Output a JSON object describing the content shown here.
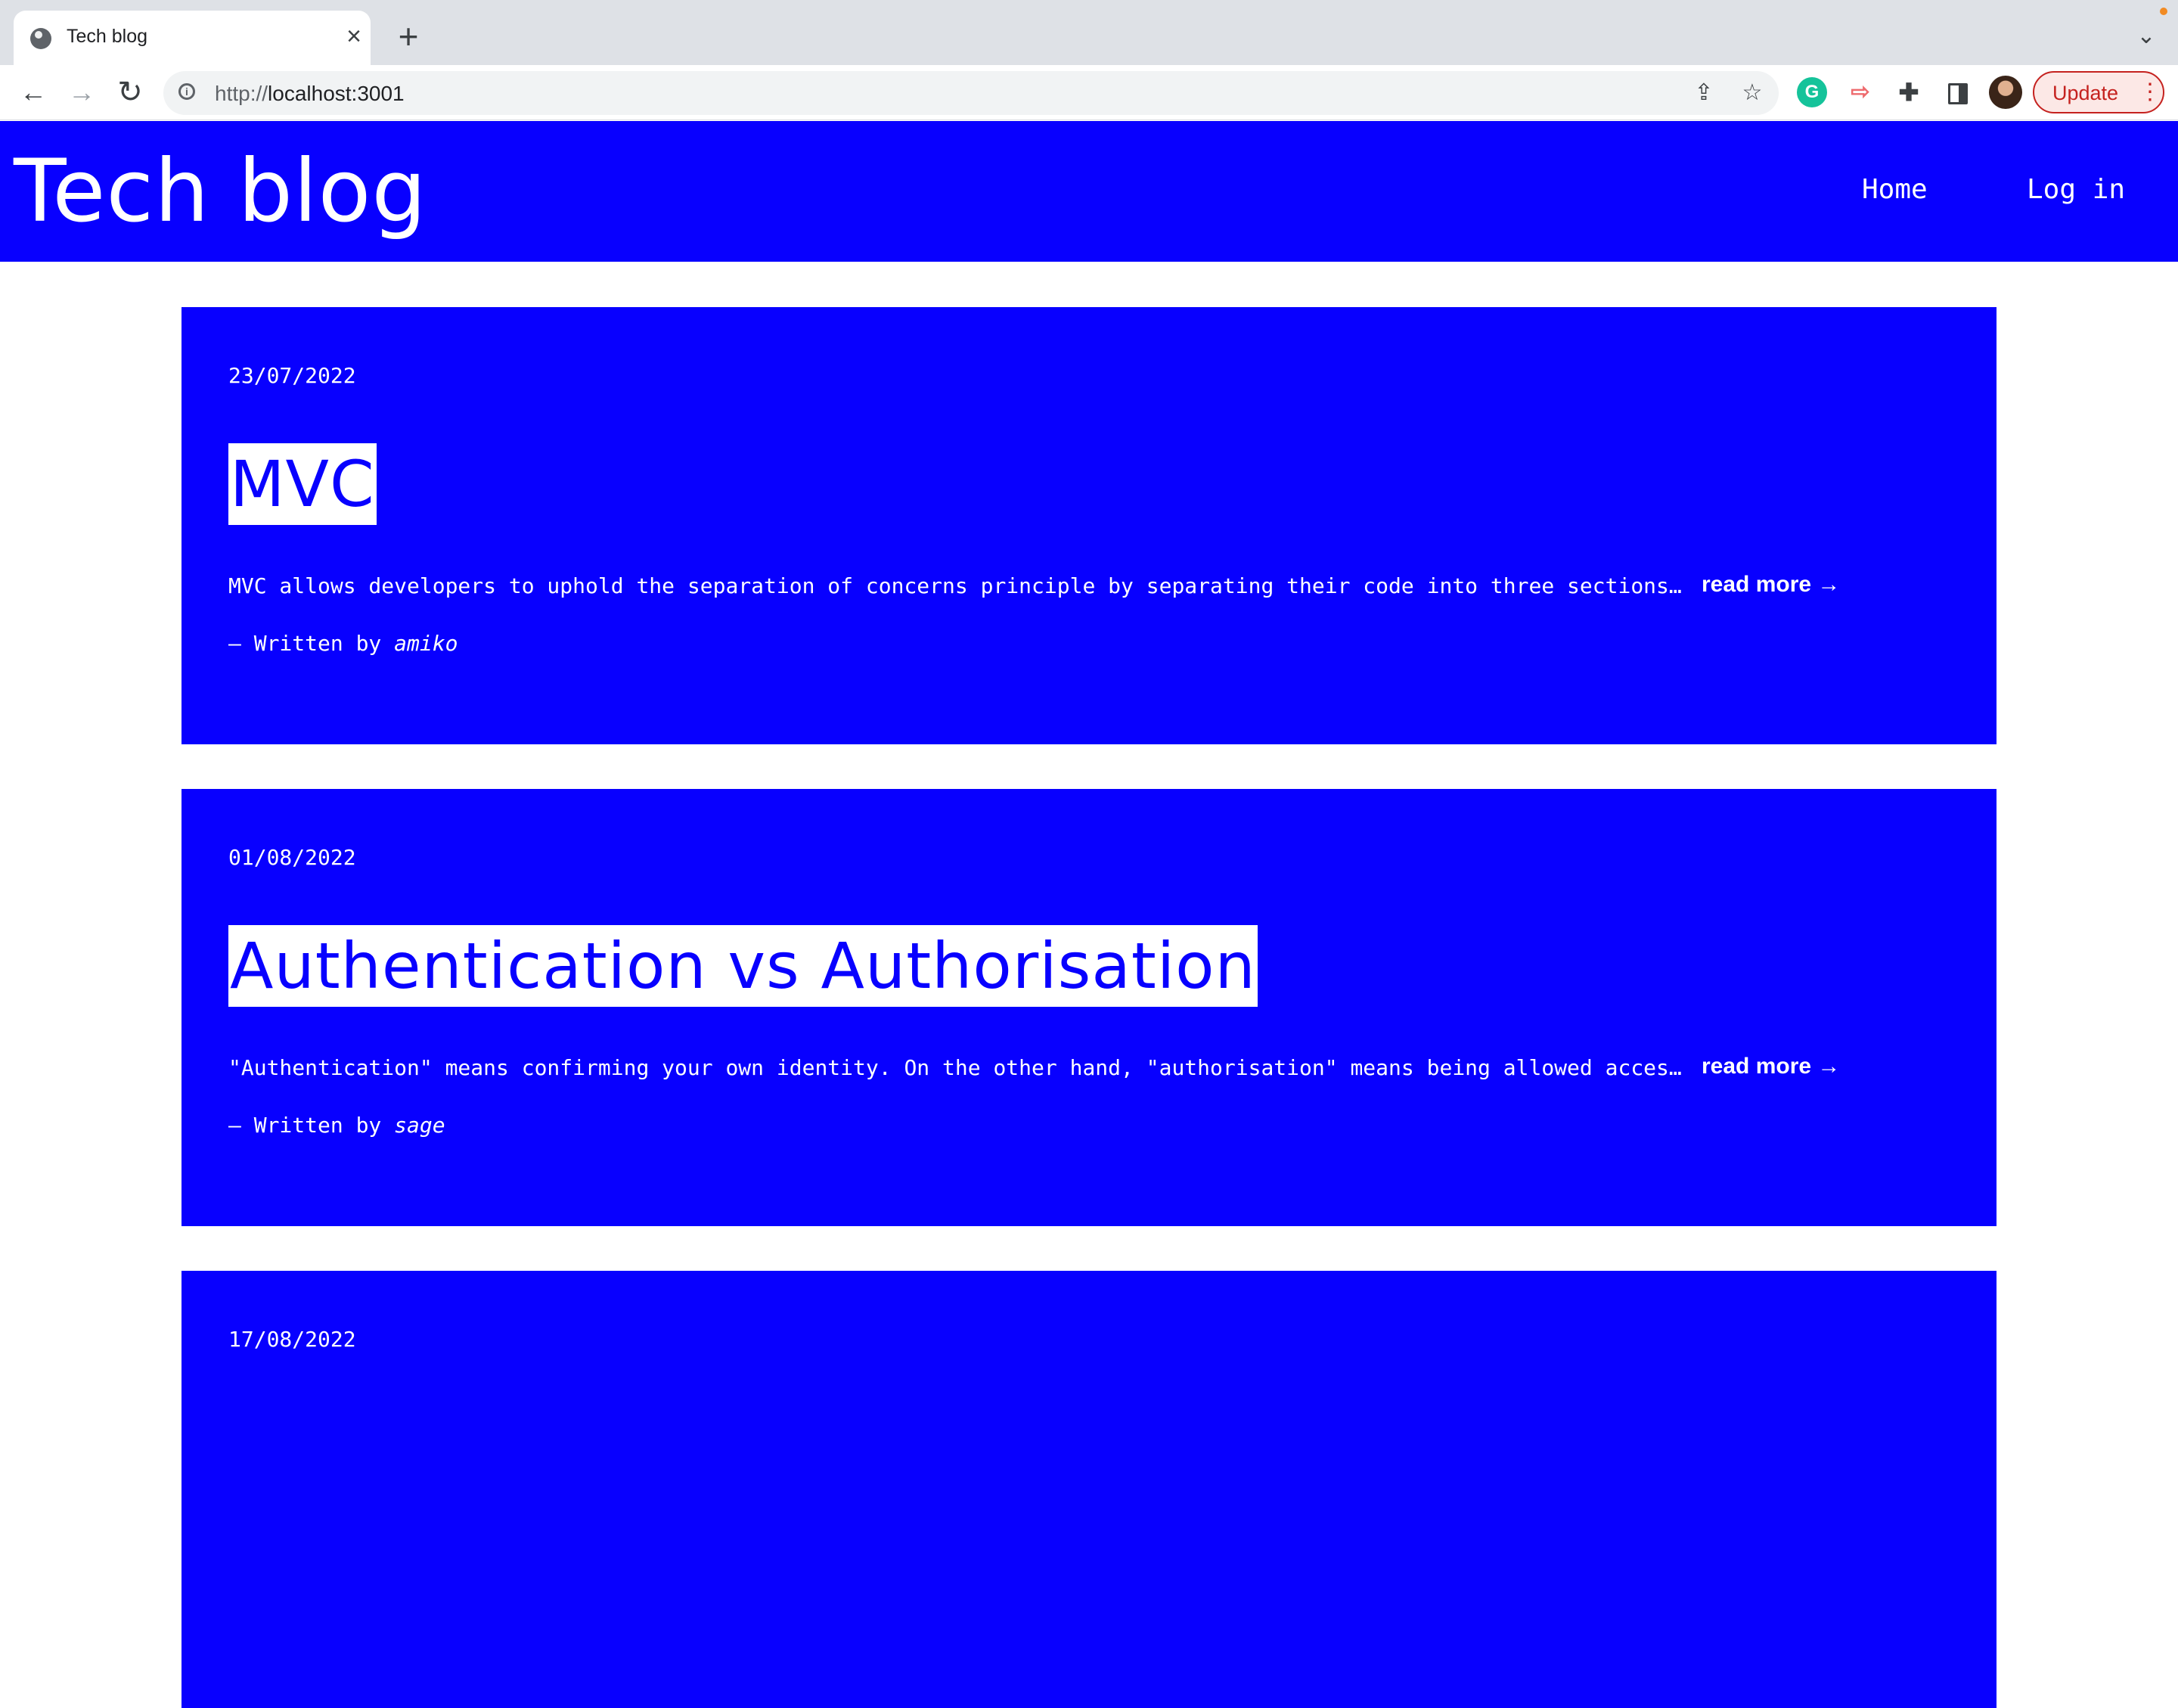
{
  "browser": {
    "tab_title": "Tech blog",
    "tab_close": "×",
    "new_tab": "+",
    "url_scheme": "http://",
    "url_host": "localhost:3001",
    "update_label": "Update",
    "icons": [
      "globe-icon",
      "close-icon",
      "plus-icon",
      "chevron-down-icon",
      "back-arrow-icon",
      "forward-arrow-icon",
      "reload-icon",
      "info-icon",
      "share-icon",
      "star-icon",
      "grammarly-icon",
      "cast-icon",
      "puzzle-icon",
      "side-panel-icon",
      "avatar",
      "kebab-menu-icon"
    ]
  },
  "site": {
    "title": "Tech blog",
    "nav": {
      "home": "Home",
      "login": "Log in"
    },
    "accent_color": "#0800ff"
  },
  "posts": [
    {
      "date": "23/07/2022",
      "title": "MVC",
      "excerpt": "MVC allows developers to uphold the separation of concerns principle by separating their code into three sections…",
      "read_more": "read more →",
      "byline_prefix": "— Written by ",
      "author": "amiko"
    },
    {
      "date": "01/08/2022",
      "title": "Authentication vs Authorisation",
      "excerpt": "\"Authentication\" means confirming your own identity. On the other hand, \"authorisation\" means being allowed acces…",
      "read_more": "read more →",
      "byline_prefix": "— Written by ",
      "author": "sage"
    },
    {
      "date": "17/08/2022"
    }
  ]
}
